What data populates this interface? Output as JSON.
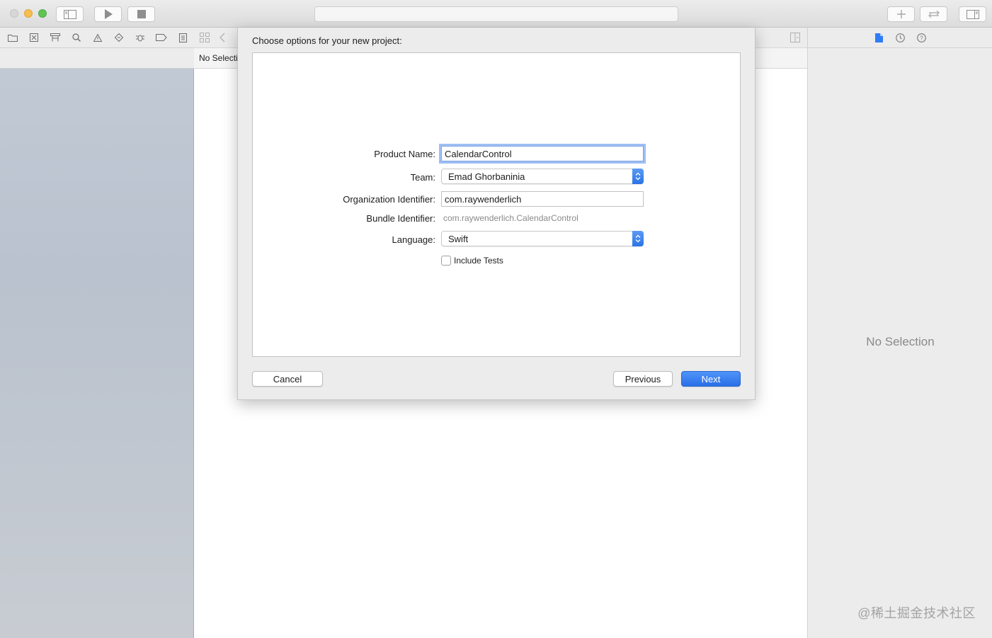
{
  "window": {
    "controls": [
      "close",
      "minimize",
      "zoom"
    ]
  },
  "toolbar": {
    "icons": [
      "navigator-toggle-icon",
      "run-icon",
      "stop-icon",
      "library-icon",
      "review-icon",
      "inspector-toggle-icon"
    ]
  },
  "navigator": {
    "tabs": [
      "folder-icon",
      "source-control-icon",
      "hierarchy-icon",
      "search-icon",
      "warning-icon",
      "test-icon",
      "debug-icon",
      "breakpoint-icon",
      "report-icon"
    ]
  },
  "editor": {
    "path_label": "No Selecti"
  },
  "inspector": {
    "tabs": [
      "file-icon",
      "history-icon",
      "help-icon"
    ],
    "empty_label": "No Selection",
    "watermark": "@稀土掘金技术社区"
  },
  "dialog": {
    "title": "Choose options for your new project:",
    "fields": {
      "product_name_label": "Product Name:",
      "product_name_value": "CalendarControl",
      "team_label": "Team:",
      "team_value": "Emad Ghorbaninia",
      "org_id_label": "Organization Identifier:",
      "org_id_value": "com.raywenderlich",
      "bundle_id_label": "Bundle Identifier:",
      "bundle_id_value": "com.raywenderlich.CalendarControl",
      "language_label": "Language:",
      "language_value": "Swift",
      "include_tests_label": "Include Tests"
    },
    "buttons": {
      "cancel": "Cancel",
      "previous": "Previous",
      "next": "Next"
    },
    "accent_color": "#2a6fe8"
  }
}
